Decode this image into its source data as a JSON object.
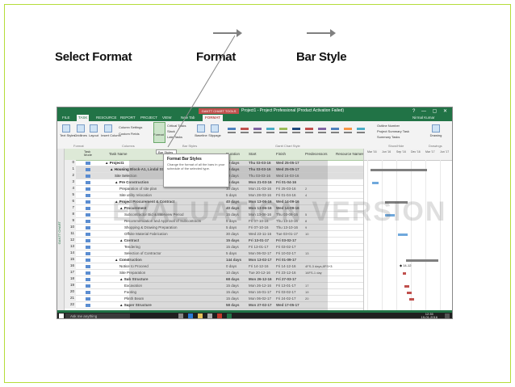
{
  "captions": {
    "select_format": "Select Format",
    "format": "Format",
    "bar_style": "Bar Style"
  },
  "window": {
    "context_tab": "GANTT CHART TOOLS",
    "title": "Project1 - Project Professional (Product Activation Failed)",
    "controls": "?  —  ▢  ✕"
  },
  "tabs": [
    {
      "label": "FILE"
    },
    {
      "label": "TASK"
    },
    {
      "label": "RESOURCE"
    },
    {
      "label": "REPORT"
    },
    {
      "label": "PROJECT"
    },
    {
      "label": "VIEW"
    },
    {
      "label": "New Tab"
    },
    {
      "label": "FORMAT"
    }
  ],
  "user": "Nirmal Kumar",
  "ribbon": {
    "text_styles": "Text Styles",
    "gridlines": "Gridlines",
    "layout": "Layout",
    "insert_column": "Insert Column",
    "column_settings": "Column Settings",
    "custom_fields": "Custom Fields",
    "format": "Format",
    "critical_tasks": "Critical Tasks",
    "slack": "Slack",
    "late_tasks": "Late Tasks",
    "baseline": "Baseline",
    "slippage": "Slippage",
    "outline_number": "Outline Number",
    "project_summary_task": "Project Summary Task",
    "summary_tasks": "Summary Tasks",
    "drawing": "Drawing",
    "groups": {
      "format": "Format",
      "columns": "Columns",
      "bar_styles": "Bar Styles",
      "gantt_chart_style": "Gantt Chart Style",
      "show_hide": "Show/Hide",
      "drawings": "Drawings"
    }
  },
  "format_menu": "Bar Styles",
  "tooltip": {
    "title": "Format Bar Styles",
    "description": "Change the format of all the bars in your schedule of the selected type."
  },
  "side_label": "GANTT CHART",
  "grid_headers": {
    "info": "",
    "mode": "Task Mode",
    "name": "Task Name",
    "duration": "Duration",
    "start": "Start",
    "finish": "Finish",
    "predecessors": "Predecessors",
    "resource": "Resource Names"
  },
  "rows": [
    {
      "id": "0",
      "name": "▲ Project1",
      "indent": 0,
      "bold": true,
      "duration": "60 days",
      "start": "Thu 03-03-16",
      "finish": "Wed 25-05-17",
      "pred": ""
    },
    {
      "id": "1",
      "name": "▲ Housing Block-A1, Lindal Street",
      "indent": 1,
      "bold": true,
      "duration": "60 days",
      "start": "Thu 03-03-16",
      "finish": "Wed 25-05-17",
      "pred": ""
    },
    {
      "id": "2",
      "name": "Site Selection",
      "indent": 2,
      "bold": false,
      "duration": "10 days",
      "start": "Thu 03-03-16",
      "finish": "Wed 16-03-16",
      "pred": ""
    },
    {
      "id": "3",
      "name": "▲ Pre Construction",
      "indent": 2,
      "bold": true,
      "duration": "15 days",
      "start": "Mon 21-03-16",
      "finish": "Fri 01-04-16",
      "pred": ""
    },
    {
      "id": "4",
      "name": "Preparation of site plan",
      "indent": 3,
      "bold": false,
      "duration": "10 days",
      "start": "Mon 21-03-16",
      "finish": "Fri 25-03-16",
      "pred": "2"
    },
    {
      "id": "5",
      "name": "Site utility relocation",
      "indent": 3,
      "bold": false,
      "duration": "5 days",
      "start": "Mon 28-03-16",
      "finish": "Fri 01-04-16",
      "pred": "4"
    },
    {
      "id": "6",
      "name": "▲ Project Procurement & Contract",
      "indent": 2,
      "bold": true,
      "duration": "40 days",
      "start": "Mon 13-06-16",
      "finish": "Wed 14-09-16",
      "pred": ""
    },
    {
      "id": "7",
      "name": "▲ Procurement",
      "indent": 3,
      "bold": true,
      "duration": "40 days",
      "start": "Mon 13-06-16",
      "finish": "Wed 14-09-16",
      "pred": ""
    },
    {
      "id": "8",
      "name": "Subcontractor Bid & Interview Period",
      "indent": 4,
      "bold": false,
      "duration": "15 days",
      "start": "Mon 13-06-16",
      "finish": "Thu 03-08-16",
      "pred": "5"
    },
    {
      "id": "9",
      "name": "Recommendation and Approval of Subcontracts",
      "indent": 4,
      "bold": false,
      "duration": "5 days",
      "start": "Fri 07-10-16",
      "finish": "Thu 13-10-16",
      "pred": "8"
    },
    {
      "id": "10",
      "name": "Shopping & Drawing Preparation",
      "indent": 4,
      "bold": false,
      "duration": "5 days",
      "start": "Fri 07-10-16",
      "finish": "Thu 13-10-16",
      "pred": "9"
    },
    {
      "id": "11",
      "name": "Offsite Material Fabrication",
      "indent": 4,
      "bold": false,
      "duration": "30 days",
      "start": "Wed 23-11-16",
      "finish": "Tue 03-01-17",
      "pred": "10"
    },
    {
      "id": "12",
      "name": "▲ Contract",
      "indent": 3,
      "bold": true,
      "duration": "15 days",
      "start": "Fri 13-01-17",
      "finish": "Fri 03-02-17",
      "pred": ""
    },
    {
      "id": "13",
      "name": "Tendering",
      "indent": 4,
      "bold": false,
      "duration": "15 days",
      "start": "Fri 13-01-17",
      "finish": "Fri 03-02-17",
      "pred": ""
    },
    {
      "id": "14",
      "name": "Selection of Contractor",
      "indent": 4,
      "bold": false,
      "duration": "5 days",
      "start": "Mon 06-02-17",
      "finish": "Fri 10-02-17",
      "pred": "13"
    },
    {
      "id": "15",
      "name": "▲ Construction",
      "indent": 2,
      "bold": true,
      "duration": "144 days",
      "start": "Mon 13-02-17",
      "finish": "Fri 01-09-17",
      "pred": ""
    },
    {
      "id": "16",
      "name": "Notice to Proceed",
      "indent": 3,
      "bold": false,
      "duration": "0 days",
      "start": "Fri 14-12-16",
      "finish": "Fri 14-12-16",
      "pred": "4FS-3 days,8FS+3"
    },
    {
      "id": "17",
      "name": "Site Preparation",
      "indent": 3,
      "bold": false,
      "duration": "10 days",
      "start": "Tue 20-12-16",
      "finish": "Fri 23-12-16",
      "pred": "16FS-1 day"
    },
    {
      "id": "18",
      "name": "▲ Sub Structure",
      "indent": 3,
      "bold": true,
      "duration": "68 days",
      "start": "Mon 26-12-16",
      "finish": "Fri 27-03-17",
      "pred": ""
    },
    {
      "id": "19",
      "name": "Excavation",
      "indent": 4,
      "bold": false,
      "duration": "15 days",
      "start": "Mon 26-12-16",
      "finish": "Fri 13-01-17",
      "pred": "17"
    },
    {
      "id": "20",
      "name": "Footing",
      "indent": 4,
      "bold": false,
      "duration": "15 days",
      "start": "Mon 16-01-17",
      "finish": "Fri 03-02-17",
      "pred": "19"
    },
    {
      "id": "21",
      "name": "Plinth Beam",
      "indent": 4,
      "bold": false,
      "duration": "15 days",
      "start": "Mon 06-02-17",
      "finish": "Fri 24-02-17",
      "pred": "20"
    },
    {
      "id": "22",
      "name": "▲ Super Structure",
      "indent": 3,
      "bold": true,
      "duration": "58 days",
      "start": "Mon 27-02-17",
      "finish": "Wed 17-05-17",
      "pred": ""
    }
  ],
  "gantt_timescale": [
    "Mar '16",
    "Jun '16",
    "Sep '16",
    "Dec '16",
    "Mar '17",
    "Jun '17"
  ],
  "gantt_labels": {
    "milestone": "14-12",
    "arrow_note": "◆ 14-12"
  },
  "watermark": "EVALUATION VERSION",
  "taskbar": {
    "search": "Ask me anything",
    "time": "12:35",
    "date": "19-01-2016"
  },
  "colors": {
    "frame": "#b5dc3a",
    "project_green": "#217346",
    "format_tab": "#c0504d",
    "selection": "#dedede"
  }
}
